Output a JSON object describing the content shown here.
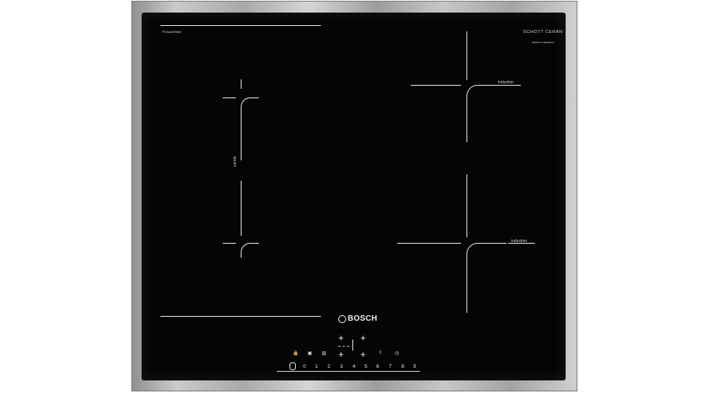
{
  "hob": {
    "model": "PVS645FB5E",
    "glass_brand": "SCHOTT CERAN",
    "glass_sub": "MADE IN GERMANY",
    "brand": "BOSCH",
    "zones": {
      "combi_label": "combi",
      "induction_top_label": "induction",
      "induction_bottom_label": "induction"
    },
    "controls": {
      "child_lock_label": "",
      "move_label": "",
      "combi_label": "",
      "boost_label": "",
      "timer_icon": "clock-icon",
      "power_icon": "power-icon"
    },
    "slider": {
      "digits": [
        "0",
        "1",
        "2",
        "3",
        "4",
        "5",
        "6",
        "7",
        "8",
        "9"
      ],
      "separator": "·"
    }
  },
  "colors": {
    "glass": "#050505",
    "frame": "#b8b9bb",
    "print": "#e8e8e8"
  }
}
